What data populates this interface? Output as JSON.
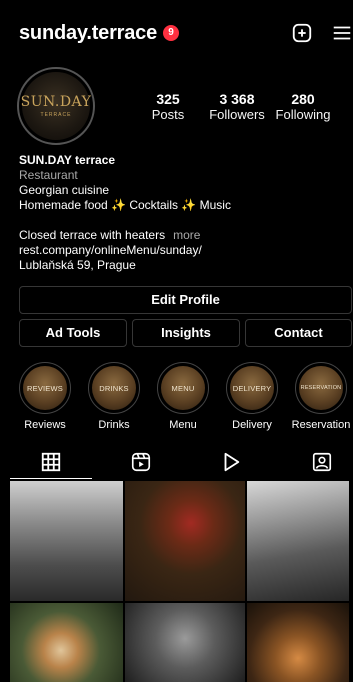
{
  "header": {
    "username": "sunday.terrace",
    "notification_count": "9",
    "icons": [
      "new-post-icon",
      "menu-icon"
    ]
  },
  "profile": {
    "avatar_text": "SUN.DAY",
    "avatar_subtext": "TERRACE",
    "stats": [
      {
        "value": "325",
        "label": "Posts"
      },
      {
        "value": "3 368",
        "label": "Followers"
      },
      {
        "value": "280",
        "label": "Following"
      }
    ]
  },
  "bio": {
    "name": "SUN.DAY terrace",
    "category": "Restaurant",
    "line1": "Georgian cuisine",
    "line2": "Homemade food ✨ Cocktails ✨ Music",
    "line3": "Closed terrace with heaters",
    "more": "more",
    "link": "rest.company/onlineMenu/sunday/",
    "address": "Lublaňská 59, Prague"
  },
  "buttons": {
    "edit_profile": "Edit Profile",
    "ad_tools": "Ad Tools",
    "insights": "Insights",
    "contact": "Contact"
  },
  "highlights": [
    {
      "cover_text": "REVIEWS",
      "label": "Reviews"
    },
    {
      "cover_text": "DRINKS",
      "label": "Drinks"
    },
    {
      "cover_text": "MENU",
      "label": "Menu"
    },
    {
      "cover_text": "DELIVERY",
      "label": "Delivery"
    },
    {
      "cover_text": "RESERVATION",
      "label": "Reservation"
    }
  ],
  "tabs": [
    "grid-icon",
    "reels-icon",
    "video-icon",
    "tagged-icon"
  ],
  "colors": {
    "background": "#000000",
    "badge": "#ff3040",
    "secondary_text": "#a8a8a8",
    "button_border": "#363636"
  }
}
